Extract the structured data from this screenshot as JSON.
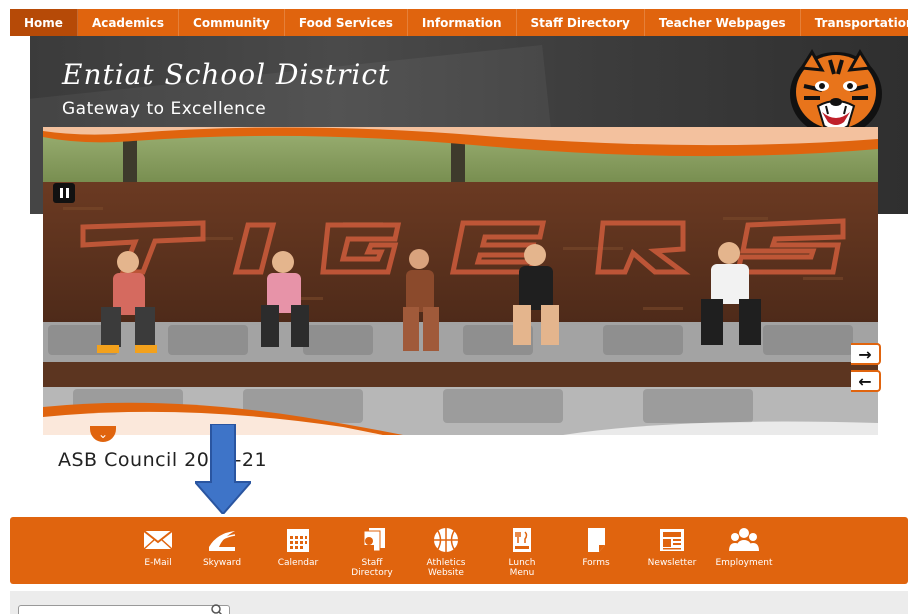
{
  "nav": {
    "items": [
      "Home",
      "Academics",
      "Community",
      "Food Services",
      "Information",
      "Staff Directory",
      "Teacher Webpages",
      "Transportation"
    ]
  },
  "header": {
    "title": "Entiat School District",
    "subtitle": "Gateway to Excellence",
    "logo": "tiger-head-logo"
  },
  "hero": {
    "caption": "ASB Council 2020-21",
    "sign_text": "TIGERS",
    "controls": {
      "pause_icon": "pause-icon",
      "next_icon": "→",
      "prev_icon": "←",
      "expand_icon": "chevron-down-icon"
    }
  },
  "quick_links": [
    {
      "label": "E-Mail",
      "icon": "envelope-icon"
    },
    {
      "label": "Skyward",
      "icon": "skyward-icon"
    },
    {
      "label": "Calendar",
      "icon": "calendar-icon"
    },
    {
      "label": "Staff\nDirectory",
      "icon": "directory-icon"
    },
    {
      "label": "Athletics\nWebsite",
      "icon": "basketball-icon"
    },
    {
      "label": "Lunch\nMenu",
      "icon": "lunch-menu-icon"
    },
    {
      "label": "Forms",
      "icon": "forms-icon"
    },
    {
      "label": "Newsletter",
      "icon": "newsletter-icon"
    },
    {
      "label": "Employment",
      "icon": "people-icon"
    }
  ],
  "colors": {
    "accent": "#e0640e",
    "header_bg": "#3b3b3b",
    "annotation_arrow": "#3e74c8"
  }
}
